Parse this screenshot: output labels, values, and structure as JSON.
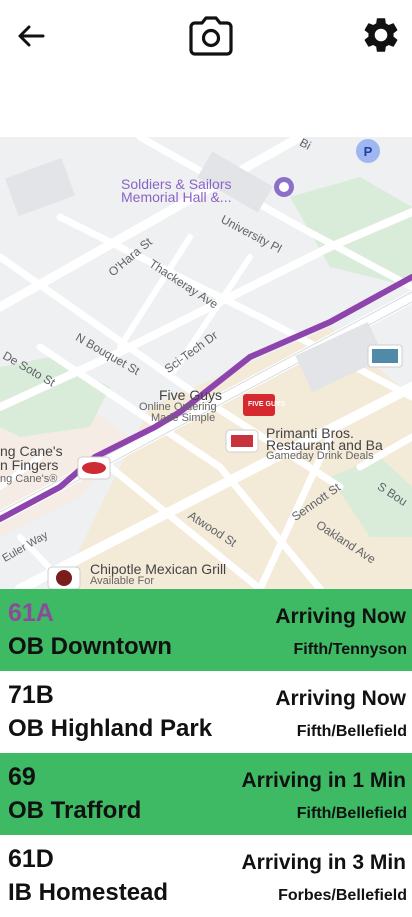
{
  "toolbar": {
    "back_icon": "arrow-left-icon",
    "camera_icon": "camera-icon",
    "settings_icon": "gear-icon"
  },
  "map": {
    "labels": {
      "soldiers": "Soldiers & Sailors",
      "memorial": "Memorial Hall &...",
      "ohara": "O'Hara St",
      "university": "University Pl",
      "thackeray": "Thackeray Ave",
      "scitech": "Sci-Tech Dr",
      "bouquet": "N Bouquet St",
      "desoto": "De Soto St",
      "fiveguys": "Five Guys",
      "online": "Online Ordering",
      "madesimple": "Made Simple",
      "primanti1": "Primanti Bros.",
      "primanti2": "Restaurant and Ba",
      "gameday": "Gameday Drink Deals",
      "canes1": "ng Cane's",
      "canes2": "n Fingers",
      "canes3": "ng Cane's®",
      "atwood": "Atwood St",
      "sennott": "Sennott St",
      "oakland": "Oakland Ave",
      "sbou": "S Bou",
      "euler": "Euler Way",
      "chipotle": "Chipotle Mexican Grill",
      "available": "Available For",
      "fiveguys_logo": "FIVE GUYS",
      "parking": "P",
      "bi": "Bi"
    }
  },
  "arrivals": [
    {
      "route": "61A",
      "destination": "OB Downtown",
      "status": "Arriving Now",
      "stop": "Fifth/Tennyson",
      "highlight": true
    },
    {
      "route": "71B",
      "destination": "OB Highland Park",
      "status": "Arriving Now",
      "stop": "Fifth/Bellefield",
      "highlight": false
    },
    {
      "route": "69",
      "destination": "OB Trafford",
      "status": "Arriving in 1 Min",
      "stop": "Fifth/Bellefield",
      "highlight": true
    },
    {
      "route": "61D",
      "destination": "IB Homestead",
      "status": "Arriving in 3 Min",
      "stop": "Forbes/Bellefield",
      "highlight": false
    }
  ],
  "colors": {
    "row_green": "#3dba63",
    "route_purple": "#8b4b9a",
    "transit_line": "#8e44ad"
  }
}
